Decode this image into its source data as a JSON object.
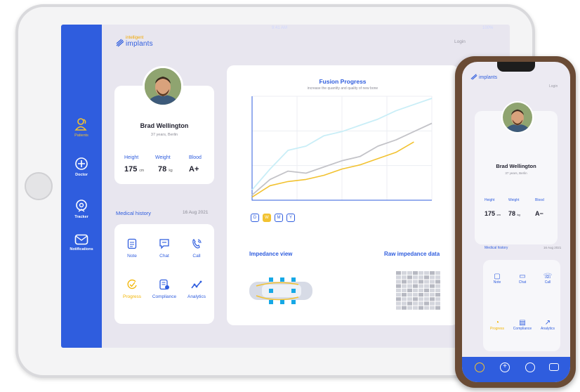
{
  "app": {
    "logo_top": "intelligent",
    "logo_bottom": "implants",
    "login": "Login"
  },
  "statusbar": {
    "left": "●●●○○",
    "time": "9:41 AM",
    "right": "100%"
  },
  "sidebar": {
    "items": [
      {
        "label": "Patients",
        "icon": "patients-icon"
      },
      {
        "label": "Doctor",
        "icon": "plus-circle-icon"
      },
      {
        "label": "Tracker",
        "icon": "tracker-icon"
      },
      {
        "label": "Notifications",
        "icon": "mail-icon"
      }
    ]
  },
  "profile": {
    "name": "Brad Wellington",
    "subtitle": "37 years, Berlin",
    "height_label": "Height",
    "height_value": "175",
    "height_unit": "cm",
    "weight_label": "Weight",
    "weight_value": "78",
    "weight_unit": "kg",
    "blood_label": "Blood",
    "blood_value": "A+"
  },
  "history": {
    "title": "Medical history",
    "date": "16 Aug 2021",
    "items": [
      {
        "label": "Note",
        "icon": "note-icon"
      },
      {
        "label": "Chat",
        "icon": "chat-icon"
      },
      {
        "label": "Call",
        "icon": "call-icon"
      },
      {
        "label": "Progress",
        "icon": "progress-icon",
        "active": true
      },
      {
        "label": "Compliance",
        "icon": "compliance-icon"
      },
      {
        "label": "Analytics",
        "icon": "analytics-icon"
      }
    ]
  },
  "chart": {
    "title": "Fusion Progress",
    "subtitle": "increase the quantity and quality of new bone",
    "segments": [
      "D",
      "W",
      "M",
      "Y"
    ],
    "active_segment": "W",
    "colors": {
      "gold": "#f2c230",
      "gray": "#c3c3c8",
      "cyan": "#c9eef7",
      "blue": "#2f5dde"
    }
  },
  "chart_data": {
    "type": "line",
    "title": "Fusion Progress",
    "subtitle": "increase the quantity and quality of new bone",
    "x": [
      0,
      1,
      2,
      3,
      4,
      5,
      6,
      7,
      8,
      9,
      10
    ],
    "ylim": [
      0,
      100
    ],
    "grid": true,
    "series": [
      {
        "color": "#c9eef7",
        "values": [
          10,
          30,
          48,
          52,
          62,
          66,
          72,
          78,
          86,
          92,
          98
        ]
      },
      {
        "color": "#c3c3c8",
        "values": [
          5,
          20,
          28,
          26,
          32,
          38,
          42,
          52,
          58,
          66,
          74
        ]
      },
      {
        "color": "#f2c230",
        "values": [
          3,
          14,
          18,
          20,
          24,
          30,
          34,
          40,
          46,
          56,
          null
        ]
      }
    ]
  },
  "impedance": {
    "view_title": "Impedance view",
    "raw_title": "Raw impedance data"
  },
  "phone": {
    "logo": "implants",
    "login": "Login",
    "name": "Brad Wellington",
    "subtitle": "37 years, Berlin",
    "height_label": "Height",
    "weight_label": "Weight",
    "blood_label": "Blood",
    "height_value": "175",
    "height_unit": "cm",
    "weight_value": "78",
    "weight_unit": "kg",
    "blood_value": "A−",
    "history_title": "Medical history",
    "history_date": "16 Aug 2021",
    "items": [
      "Note",
      "Chat",
      "Call",
      "Progress",
      "Compliance",
      "Analytics"
    ]
  }
}
